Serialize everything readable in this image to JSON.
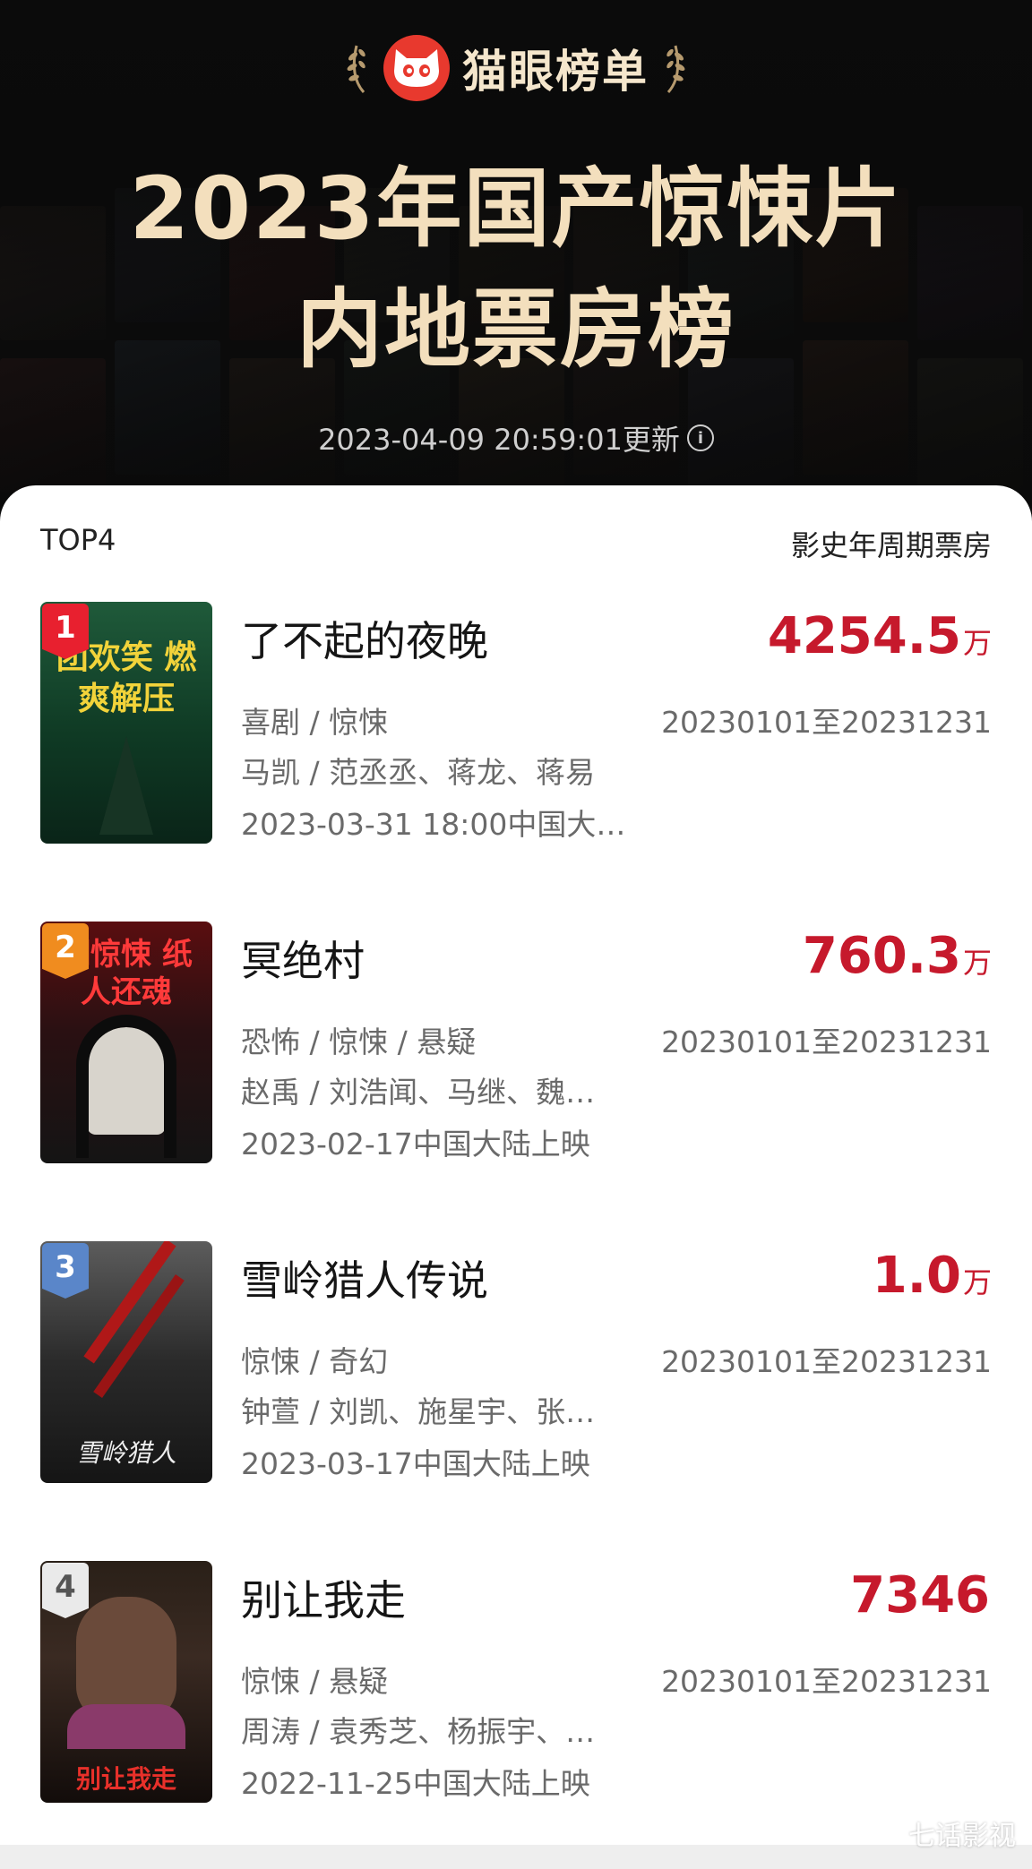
{
  "header": {
    "brand_name": "猫眼榜单",
    "title_line1": "2023年国产惊悚片",
    "title_line2": "内地票房榜",
    "updated": "2023-04-09 20:59:01更新"
  },
  "list": {
    "top_label": "TOP4",
    "metric_label": "影史年周期票房",
    "items": [
      {
        "rank": "1",
        "title": "了不起的夜晚",
        "box_office": "4254.5",
        "unit": "万",
        "genre": "喜剧 / 惊悚",
        "period": "20230101至20231231",
        "cast": "马凯 / 范丞丞、蒋龙、蒋易",
        "release": "2023-03-31 18:00中国大…",
        "poster_text": "团欢笑 燃爽解压"
      },
      {
        "rank": "2",
        "title": "冥绝村",
        "box_office": "760.3",
        "unit": "万",
        "genre": "恐怖 / 惊悚 / 悬疑",
        "period": "20230101至20231231",
        "cast": "赵禹 / 刘浩闻、马继、魏…",
        "release": "2023-02-17中国大陆上映",
        "poster_text": "明惊悚 纸人还魂"
      },
      {
        "rank": "3",
        "title": "雪岭猎人传说",
        "box_office": "1.0",
        "unit": "万",
        "genre": "惊悚 / 奇幻",
        "period": "20230101至20231231",
        "cast": "钟萱 / 刘凯、施星宇、张…",
        "release": "2023-03-17中国大陆上映",
        "poster_text": "雪岭猎人"
      },
      {
        "rank": "4",
        "title": "别让我走",
        "box_office": "7346",
        "unit": "",
        "genre": "惊悚 / 悬疑",
        "period": "20230101至20231231",
        "cast": "周涛 / 袁秀芝、杨振宇、…",
        "release": "2022-11-25中国大陆上映",
        "poster_text": "别让我走"
      }
    ]
  },
  "watermark": "七话影视",
  "colors": {
    "accent": "#c6192c",
    "title_gold": "#f3dfbd",
    "rank1": "#e8202f",
    "rank2": "#f08c1f",
    "rank3": "#5a86c9",
    "rank4": "#eaeaea"
  }
}
